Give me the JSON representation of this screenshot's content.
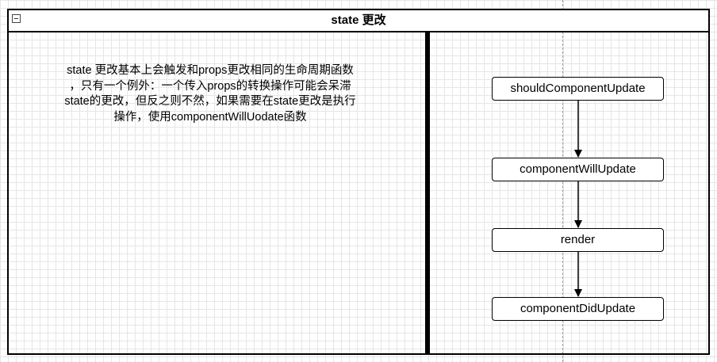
{
  "container": {
    "title": "state 更改"
  },
  "description": "state 更改基本上会触发和props更改相同的生命周期函数\n，只有一个例外：一个传入props的转换操作可能会呆滞\nstate的更改，但反之则不然，如果需要在state更改是执行\n操作，使用componentWillUodate函数",
  "flow": {
    "nodes": [
      {
        "label": "shouldComponentUpdate"
      },
      {
        "label": "componentWillUpdate"
      },
      {
        "label": "render"
      },
      {
        "label": "componentDidUpdate"
      }
    ]
  }
}
